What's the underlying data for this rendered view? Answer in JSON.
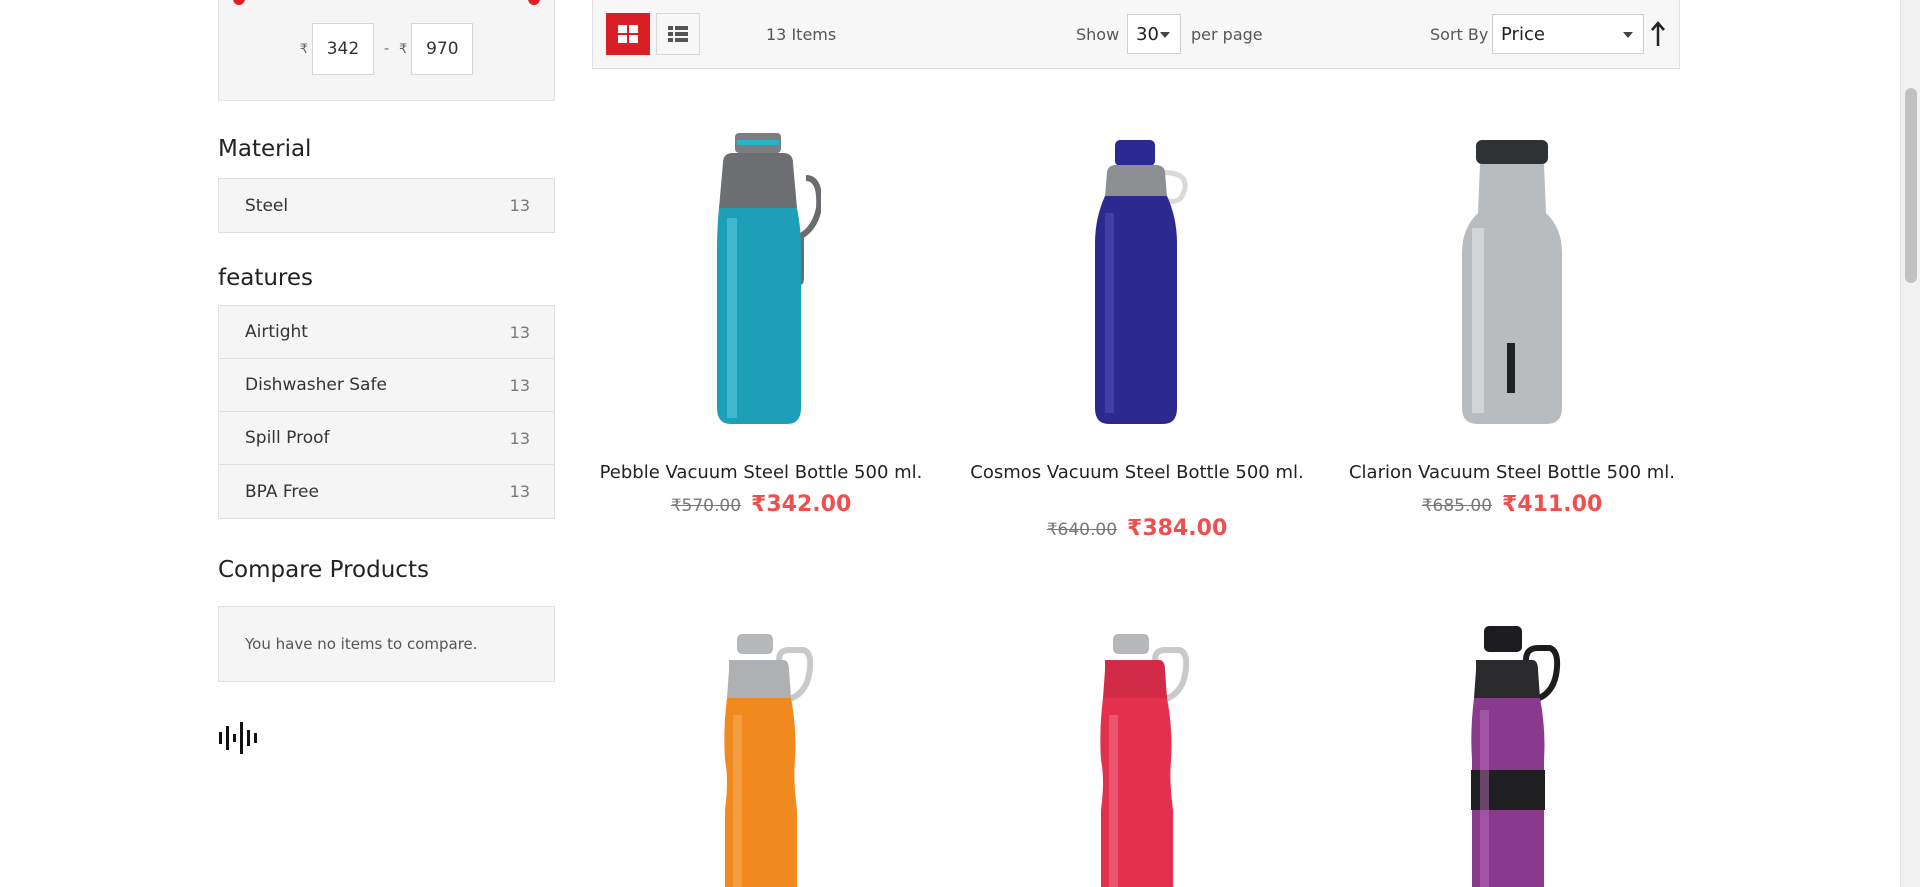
{
  "filters": {
    "price": {
      "currency": "₹",
      "min": "342",
      "max": "970",
      "separator": "-"
    },
    "material": {
      "title": "Material",
      "items": [
        {
          "label": "Steel",
          "count": "13"
        }
      ]
    },
    "features": {
      "title": "features",
      "items": [
        {
          "label": "Airtight",
          "count": "13"
        },
        {
          "label": "Dishwasher Safe",
          "count": "13"
        },
        {
          "label": "Spill Proof",
          "count": "13"
        },
        {
          "label": "BPA Free",
          "count": "13"
        }
      ]
    }
  },
  "compare": {
    "title": "Compare Products",
    "empty_text": "You have no items to compare."
  },
  "toolbar": {
    "grid_icon": "grid-view-icon",
    "list_icon": "list-view-icon",
    "item_count": "13 Items",
    "show_label": "Show",
    "per_page_value": "30",
    "per_page_label": "per page",
    "sort_label": "Sort By",
    "sort_value": "Price",
    "sort_direction_icon": "arrow-up-icon"
  },
  "products": [
    {
      "name": "Pebble Vacuum Steel Bottle 500 ml.",
      "old_price": "₹570.00",
      "price": "₹342.00",
      "color": "#1e9fb8"
    },
    {
      "name": "Cosmos Vacuum Steel Bottle 500 ml.",
      "old_price": "₹640.00",
      "price": "₹384.00",
      "color": "#2c2a8e"
    },
    {
      "name": "Clarion Vacuum Steel Bottle 500 ml.",
      "old_price": "₹685.00",
      "price": "₹411.00",
      "color": "#b9bcbf"
    },
    {
      "name": "",
      "old_price": "",
      "price": "",
      "color": "#f08a1f"
    },
    {
      "name": "",
      "old_price": "",
      "price": "",
      "color": "#e3304f"
    },
    {
      "name": "",
      "old_price": "",
      "price": "",
      "color": "#8a3a8c"
    }
  ],
  "colors": {
    "accent": "#d81f26",
    "sale_price": "#ef4f4f"
  }
}
